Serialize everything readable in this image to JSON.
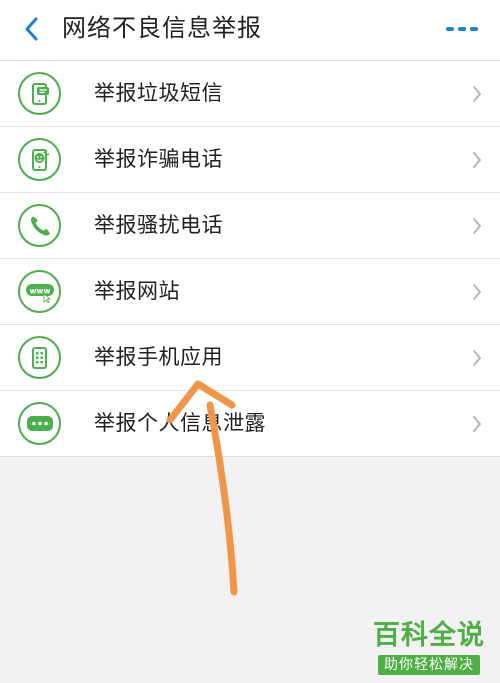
{
  "header": {
    "title": "网络不良信息举报",
    "back_icon": "chevron-left-icon",
    "more_icon": "more-dots-icon"
  },
  "menu": {
    "items": [
      {
        "label": "举报垃圾短信",
        "icon": "sms-phone-icon"
      },
      {
        "label": "举报诈骗电话",
        "icon": "fraud-phone-icon"
      },
      {
        "label": "举报骚扰电话",
        "icon": "phone-handset-icon"
      },
      {
        "label": "举报网站",
        "icon": "www-website-icon"
      },
      {
        "label": "举报手机应用",
        "icon": "mobile-app-icon"
      },
      {
        "label": "举报个人信息泄露",
        "icon": "chat-dots-icon"
      }
    ],
    "chevron_icon": "chevron-right-icon"
  },
  "annotation": {
    "color": "#f0954a",
    "points_to": "举报手机应用"
  },
  "watermark": {
    "main": "百科全说",
    "sub": "助你轻松解决"
  },
  "colors": {
    "accent_blue": "#1e7fd6",
    "icon_green": "#4cae4c",
    "watermark_green": "#4fae44",
    "annotation_orange": "#f0954a"
  }
}
